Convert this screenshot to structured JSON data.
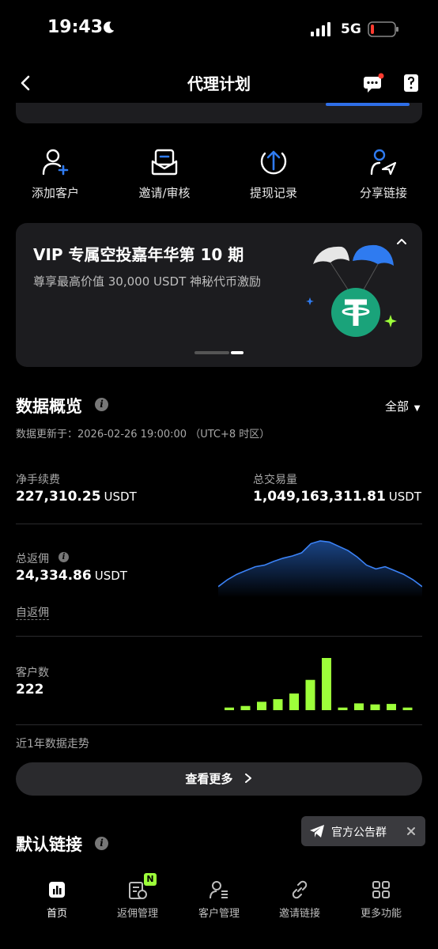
{
  "status_bar": {
    "time": "19:43",
    "network": "5G"
  },
  "header": {
    "title": "代理计划"
  },
  "quick_actions": [
    {
      "label": "添加客户",
      "icon": "add-user-icon"
    },
    {
      "label": "邀请/审核",
      "icon": "invite-review-icon"
    },
    {
      "label": "提现记录",
      "icon": "withdraw-icon"
    },
    {
      "label": "分享链接",
      "icon": "share-link-icon"
    }
  ],
  "banner": {
    "title": "VIP 专属空投嘉年华第 10 期",
    "subtitle": "尊享最高价值 30,000 USDT 神秘代币激励"
  },
  "overview": {
    "title": "数据概览",
    "filter": "全部",
    "updated": "数据更新于：2026-02-26 19:00:00 （UTC+8 时区）",
    "net_fee": {
      "label": "净手续费",
      "value": "227,310.25",
      "unit": "USDT"
    },
    "total_volume": {
      "label": "总交易量",
      "value": "1,049,163,311.81",
      "unit": "USDT"
    },
    "total_rebate": {
      "label": "总返佣",
      "value": "24,334.86",
      "unit": "USDT"
    },
    "self_rebate": "自返佣",
    "customers": {
      "label": "客户数",
      "value": "222"
    },
    "trend_note": "近1年数据走势",
    "more_button": "查看更多"
  },
  "rebate_trend": [
    0.15,
    0.28,
    0.38,
    0.45,
    0.52,
    0.55,
    0.62,
    0.68,
    0.72,
    0.78,
    0.95,
    1.0,
    0.98,
    0.9,
    0.82,
    0.7,
    0.55,
    0.48,
    0.52,
    0.45,
    0.38,
    0.28,
    0.15
  ],
  "customer_bars": [
    0.05,
    0.08,
    0.16,
    0.21,
    0.32,
    0.58,
    1.0,
    0.05,
    0.13,
    0.11,
    0.12,
    0.05
  ],
  "toast": {
    "label": "官方公告群"
  },
  "default_link": {
    "title": "默认链接"
  },
  "nav": [
    {
      "label": "首页",
      "icon": "home-icon",
      "active": true
    },
    {
      "label": "返佣管理",
      "icon": "rebate-icon",
      "badge": "N"
    },
    {
      "label": "客户管理",
      "icon": "customers-icon"
    },
    {
      "label": "邀请链接",
      "icon": "link-icon"
    },
    {
      "label": "更多功能",
      "icon": "more-icon"
    }
  ],
  "colors": {
    "accent_green": "#9dff3a",
    "accent_blue": "#2f7bf0",
    "tether_green": "#1aa37a"
  }
}
